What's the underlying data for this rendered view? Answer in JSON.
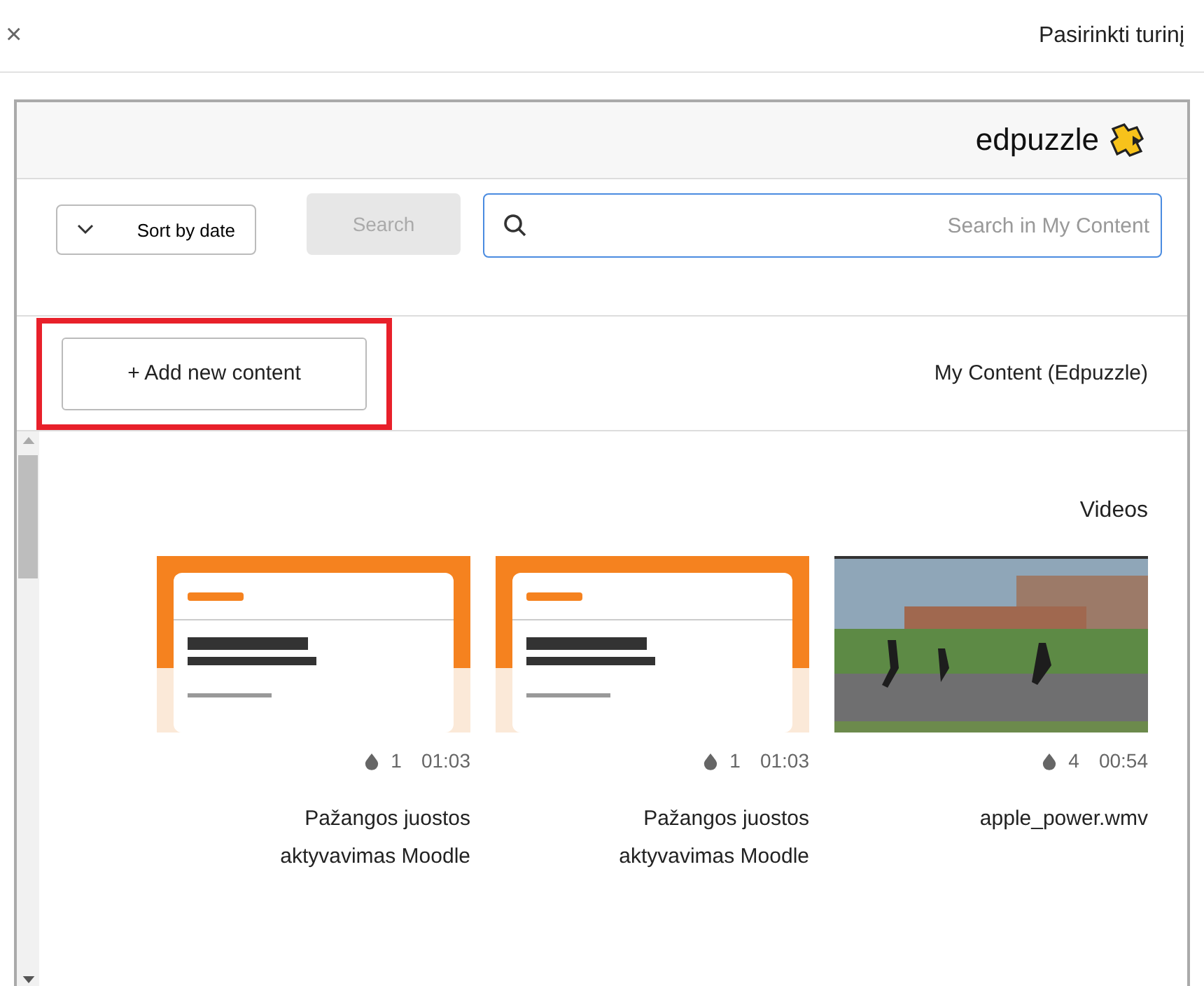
{
  "dialog": {
    "title": "Pasirinkti turinį",
    "close": "×"
  },
  "brand": {
    "name": "edpuzzle"
  },
  "search": {
    "placeholder": "Search in My Content",
    "button": "Search",
    "button_disabled": true,
    "sort": "Sort by date"
  },
  "section": {
    "title": "My Content (Edpuzzle)",
    "add_button": "+ Add new content",
    "highlighted": true
  },
  "videos": {
    "heading": "Videos",
    "items": [
      {
        "kind": "slide",
        "duration": "01:03",
        "count": "1",
        "title": "Pažangos juostos aktyvavimas Moodle"
      },
      {
        "kind": "slide",
        "duration": "01:03",
        "count": "1",
        "title": "Pažangos juostos aktyvavimas Moodle"
      },
      {
        "kind": "photo",
        "duration": "00:54",
        "count": "4",
        "title": "apple_power.wmv"
      }
    ]
  }
}
